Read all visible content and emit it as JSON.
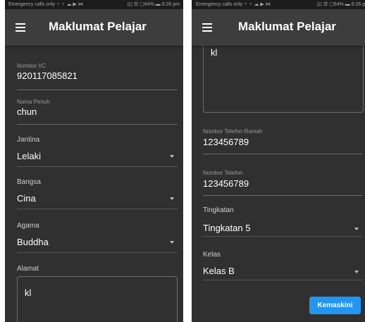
{
  "left": {
    "status": {
      "left_text": "Emergency calls only ♆ ♆ ☁ ▶ ⋈",
      "right_text": "▯▯ ☰ ▢64% ▬ 6:26 pm"
    },
    "appbar": {
      "title": "Maklumat Pelajar"
    },
    "fields": {
      "ic": {
        "label": "Nombor I/C",
        "value": "920117085821"
      },
      "name": {
        "label": "Nama Penuh",
        "value": "chun"
      },
      "gender": {
        "label": "Jantina",
        "value": "Lelaki"
      },
      "race": {
        "label": "Bangsa",
        "value": "Cina"
      },
      "religion": {
        "label": "Agama",
        "value": "Buddha"
      },
      "address": {
        "label": "Alamat",
        "value": "kl"
      }
    }
  },
  "right": {
    "status": {
      "left_text": "Emergency calls only ♆ ♆ ☁ ▶ ⋈",
      "right_text": "▯▯ ☰ ▢64% ▬ 6:26 pm"
    },
    "appbar": {
      "title": "Maklumat Pelajar"
    },
    "fields": {
      "address_value": "kl",
      "home_phone": {
        "label": "Nombor Telefon Rumah",
        "value": "123456789"
      },
      "phone": {
        "label": "Nombor Telefon",
        "value": "123456789"
      },
      "level": {
        "label": "Tingkatan",
        "value": "Tingkatan 5"
      },
      "class": {
        "label": "Kelas",
        "value": "Kelas B"
      }
    },
    "update_button": "Kemaskini"
  },
  "colors": {
    "background": "#303030",
    "appbar": "#3d3d3d",
    "accent": "#2196f3"
  }
}
